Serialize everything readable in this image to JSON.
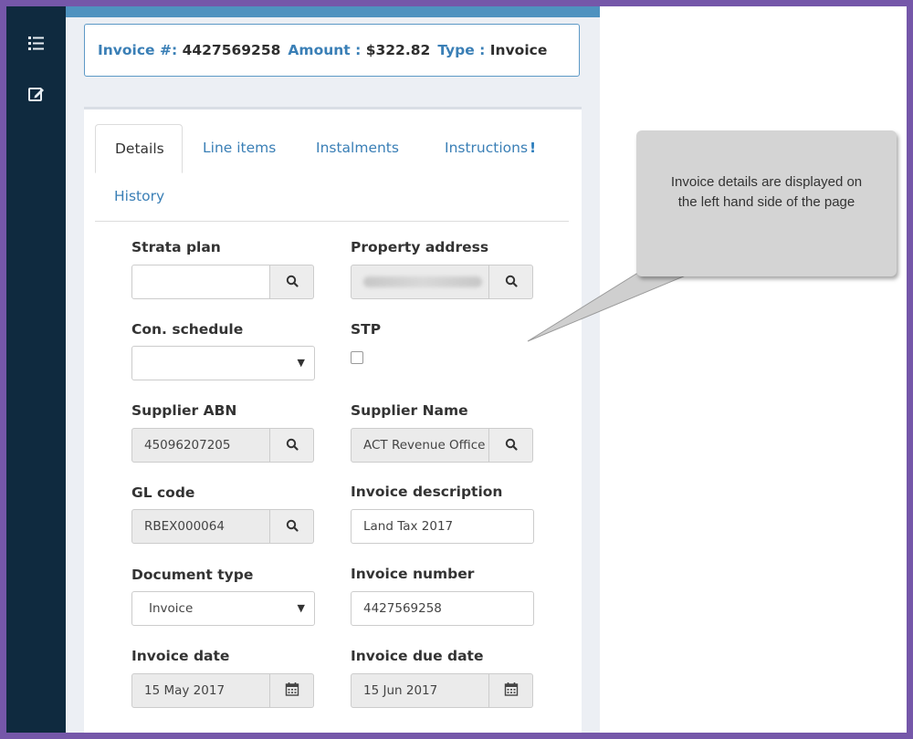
{
  "header": {
    "invoice_label": "Invoice #:",
    "invoice_value": "4427569258",
    "amount_label": "Amount :",
    "amount_value": "$322.82",
    "type_label": "Type :",
    "type_value": "Invoice"
  },
  "tabs": [
    {
      "label": "Details",
      "active": true
    },
    {
      "label": "Line items",
      "active": false
    },
    {
      "label": "Instalments",
      "active": false
    },
    {
      "label": "Instructions",
      "active": false,
      "alert": "!"
    },
    {
      "label": "History",
      "active": false
    }
  ],
  "form": {
    "strata_plan": {
      "label": "Strata plan",
      "value": ""
    },
    "property_address": {
      "label": "Property address",
      "value": ""
    },
    "con_schedule": {
      "label": "Con. schedule",
      "value": ""
    },
    "stp": {
      "label": "STP",
      "checked": false
    },
    "supplier_abn": {
      "label": "Supplier ABN",
      "value": "45096207205"
    },
    "supplier_name": {
      "label": "Supplier Name",
      "value": "ACT Revenue Office"
    },
    "gl_code": {
      "label": "GL code",
      "value": "RBEX000064"
    },
    "invoice_description": {
      "label": "Invoice description",
      "value": "Land Tax 2017"
    },
    "document_type": {
      "label": "Document type",
      "value": "Invoice"
    },
    "invoice_number": {
      "label": "Invoice number",
      "value": "4427569258"
    },
    "invoice_date": {
      "label": "Invoice date",
      "value": "15 May 2017"
    },
    "invoice_due_date": {
      "label": "Invoice due date",
      "value": "15 Jun 2017"
    }
  },
  "callout": {
    "text": "Invoice details are displayed on the left hand side of the page"
  },
  "colors": {
    "frame": "#7557a9",
    "sidebar": "#0f2a3f",
    "link": "#3a7fb6",
    "callout_bg": "#d4d4d4"
  },
  "icons": {
    "sidebar_list": "list-icon",
    "sidebar_edit": "edit-icon",
    "search": "search-icon",
    "calendar": "calendar-icon",
    "dropdown": "caret-down-icon"
  }
}
